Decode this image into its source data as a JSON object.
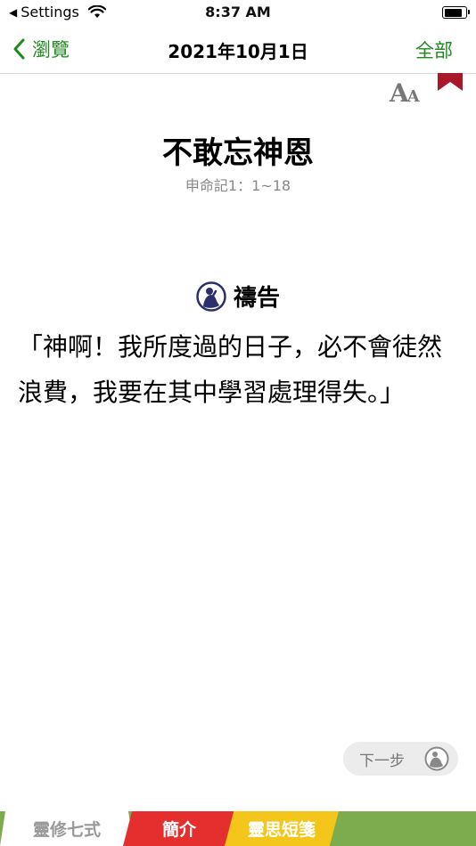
{
  "status_bar": {
    "back_app": "Settings",
    "time": "8:37 AM",
    "battery_level": 0.95
  },
  "nav": {
    "back_label": "瀏覽",
    "title": "2021年10月1日",
    "right_label": "全部"
  },
  "toolbar": {
    "font_big": "A",
    "font_small": "A"
  },
  "article": {
    "title": "不敢忘神恩",
    "reference": "申命記1：1~18"
  },
  "section": {
    "heading": "禱告",
    "body": "「神啊！我所度過的日子，必不會徒然浪費，我要在其中學習處理得失。」"
  },
  "next_button": {
    "label": "下一步"
  },
  "tabs": [
    {
      "label": "靈修七式"
    },
    {
      "label": "簡介"
    },
    {
      "label": "靈思短箋"
    }
  ],
  "colors": {
    "accent_green": "#1c8a1c",
    "bookmark_red": "#a8182a",
    "tab_bar_green": "#7cac4e",
    "tab_red": "#e52e2e",
    "tab_yellow": "#f4c51b",
    "prayer_icon_navy": "#2b2f6b"
  }
}
